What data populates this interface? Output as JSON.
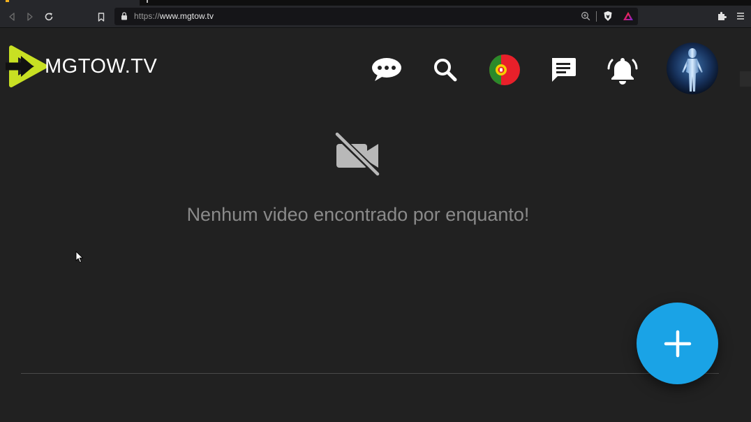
{
  "browser": {
    "url_scheme": "https://",
    "url_host": "www.mgtow.tv",
    "icons": {
      "back": "back-arrow-icon",
      "forward": "forward-arrow-icon",
      "reload": "reload-icon",
      "bookmark": "bookmark-icon",
      "lock": "lock-icon",
      "zoom": "zoom-icon",
      "shields": "brave-shield-icon",
      "rewards": "brave-rewards-icon",
      "extensions": "puzzle-icon",
      "menu": "hamburger-menu-icon"
    }
  },
  "header": {
    "logo_text": "MGTOW.TV",
    "icons": [
      "chat-bubble-icon",
      "search-icon",
      "portugal-flag-icon",
      "messages-icon",
      "bell-icon"
    ],
    "avatar": "user-avatar"
  },
  "main": {
    "empty_icon": "video-off-icon",
    "empty_message": "Nenhum video encontrado por enquanto!",
    "fab_icon": "plus-icon"
  },
  "colors": {
    "background": "#212121",
    "fab": "#1aa3e6",
    "logo_accent": "#c8e023",
    "empty_text": "#8a8a8a"
  }
}
